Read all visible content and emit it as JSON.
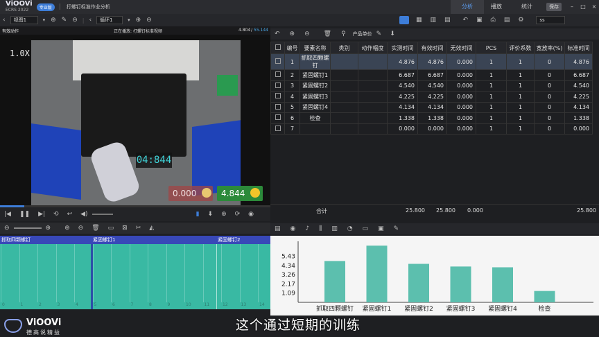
{
  "app": {
    "logo": "ViOOVi",
    "logo_sub": "ECRS 2022",
    "edition": "专业版",
    "title": "打螺钉标准作业分析"
  },
  "top_menu": [
    "分析",
    "播放",
    "统计"
  ],
  "save_button": "保存",
  "toolbar": {
    "view_select": "视图1",
    "loop_select": "循环1",
    "search_value": "ss"
  },
  "video": {
    "header_left": "有效动作",
    "header_center": "正在播放: 打螺钉标准视频",
    "header_time": "4.804",
    "header_total": "55.144",
    "speed": "1.0X",
    "timer": "04:844",
    "invalid_value": "0.000",
    "valid_value": "4.844"
  },
  "timeline": {
    "segments": [
      "抓取四颗螺钉",
      "紧固螺钉1",
      "紧固螺钉2"
    ],
    "ticks": [
      "0",
      "1",
      "2",
      "3",
      "4",
      "5",
      "6",
      "7",
      "8",
      "9",
      "10",
      "11",
      "12",
      "13",
      "14"
    ]
  },
  "table_toolbar": {
    "unit_label": "产品单价"
  },
  "table": {
    "headers": [
      "编号",
      "要素名称",
      "类别",
      "动作幅度",
      "实测时间",
      "有效时间",
      "无效时间",
      "PCS",
      "评价系数",
      "宽放率(%)",
      "标准时间"
    ],
    "rows": [
      [
        "1",
        "抓取四颗螺钉",
        "",
        "",
        "4.876",
        "4.876",
        "0.000",
        "1",
        "1",
        "0",
        "4.876"
      ],
      [
        "2",
        "紧固螺钉1",
        "",
        "",
        "6.687",
        "6.687",
        "0.000",
        "1",
        "1",
        "0",
        "6.687"
      ],
      [
        "3",
        "紧固螺钉2",
        "",
        "",
        "4.540",
        "4.540",
        "0.000",
        "1",
        "1",
        "0",
        "4.540"
      ],
      [
        "4",
        "紧固螺钉3",
        "",
        "",
        "4.225",
        "4.225",
        "0.000",
        "1",
        "1",
        "0",
        "4.225"
      ],
      [
        "5",
        "紧固螺钉4",
        "",
        "",
        "4.134",
        "4.134",
        "0.000",
        "1",
        "1",
        "0",
        "4.134"
      ],
      [
        "6",
        "检查",
        "",
        "",
        "1.338",
        "1.338",
        "0.000",
        "1",
        "1",
        "0",
        "1.338"
      ],
      [
        "7",
        "",
        "",
        "",
        "0.000",
        "0.000",
        "0.000",
        "1",
        "1",
        "0",
        "0.000"
      ]
    ],
    "total_label": "合计",
    "total_measured": "25.800",
    "total_valid": "25.800",
    "total_invalid": "0.000",
    "total_standard": "25.800"
  },
  "chart_data": {
    "type": "bar",
    "categories": [
      "抓取四颗螺钉",
      "紧固螺钉1",
      "紧固螺钉2",
      "紧固螺钉3",
      "紧固螺钉4",
      "检查"
    ],
    "values": [
      4.876,
      6.687,
      4.54,
      4.225,
      4.134,
      1.338
    ],
    "yticks": [
      "1.09",
      "2.17",
      "3.26",
      "4.34",
      "5.43"
    ],
    "ytick_values": [
      1.09,
      2.17,
      3.26,
      4.34,
      5.43
    ],
    "ylim": [
      0,
      7.2
    ],
    "bar_color": "#5cbfae"
  },
  "brand": {
    "logo": "ViOOVi",
    "slogan": "德高说精益"
  },
  "subtitle": "这个通过短期的训练"
}
